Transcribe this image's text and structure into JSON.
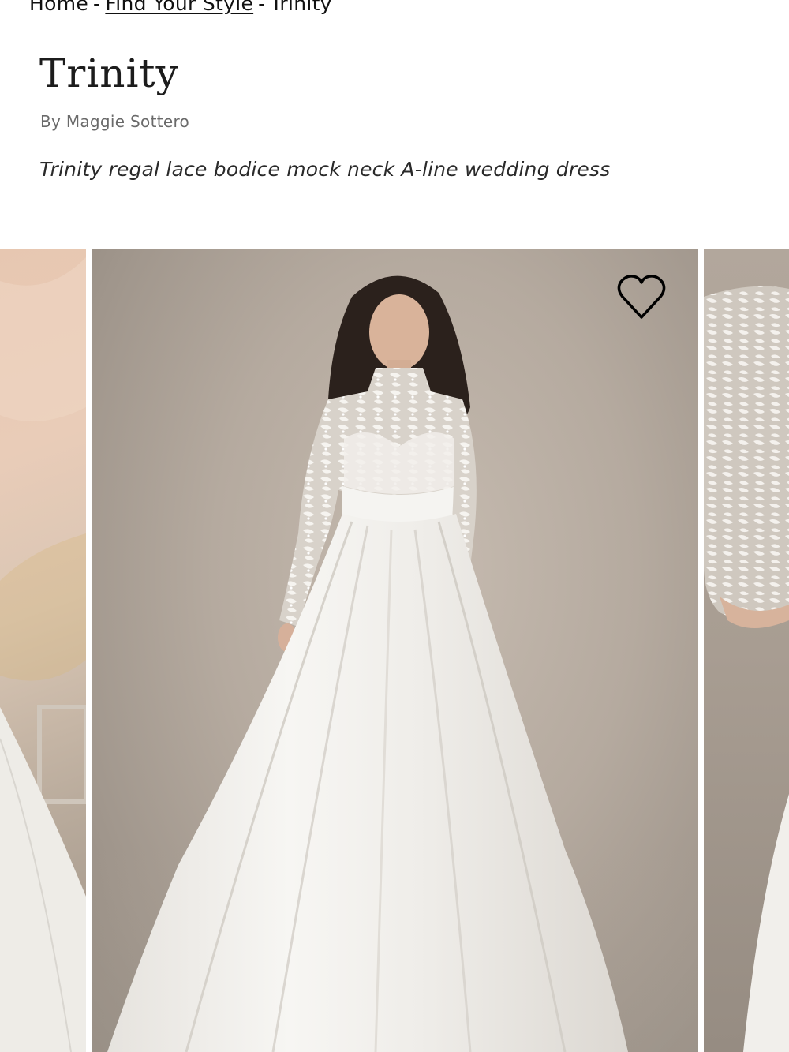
{
  "breadcrumb": {
    "home": "Home",
    "separator": "-",
    "find_your_style": "Find Your Style",
    "current": "Trinity"
  },
  "product": {
    "name": "Trinity",
    "designer": "By Maggie Sottero",
    "description": "Trinity regal lace bodice mock neck A-line wedding dress"
  },
  "gallery": {
    "favorite_icon": "heart-outline-icon"
  },
  "colors": {
    "text": "#1c1c1c",
    "muted": "#6a6a6a",
    "backdrop": "#b5aa9f",
    "dress": "#f4f2ee"
  }
}
